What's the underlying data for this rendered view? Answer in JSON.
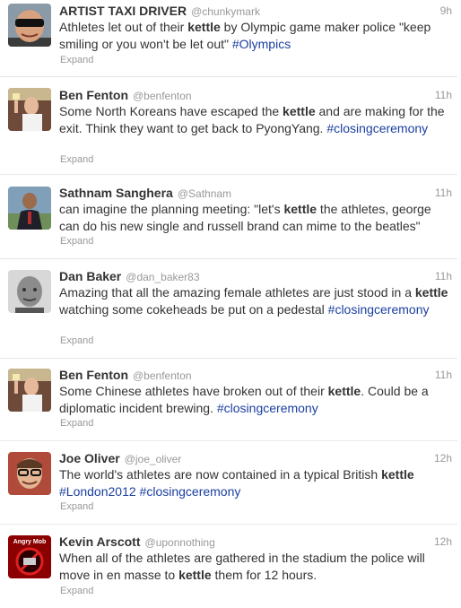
{
  "tweets": [
    {
      "name": "ARTIST TAXI DRIVER",
      "handle": "@chunkymark",
      "time": "9h",
      "avatar_icon": "sunglasses-man-avatar",
      "segments": [
        {
          "t": "Athletes let out of their "
        },
        {
          "t": "kettle",
          "kind": "bold"
        },
        {
          "t": " by Olympic game maker police \"keep smiling or you won't be let out\" "
        },
        {
          "t": "#Olympics",
          "kind": "tag"
        }
      ],
      "expand": "Expand"
    },
    {
      "name": "Ben Fenton",
      "handle": "@benfenton",
      "time": "11h",
      "avatar_icon": "man-raising-glass-avatar",
      "segments": [
        {
          "t": "Some North Koreans have escaped the "
        },
        {
          "t": "kettle",
          "kind": "bold"
        },
        {
          "t": " and are making for the exit. Think they want to get back to PyongYang. "
        },
        {
          "t": "#closingceremony",
          "kind": "tag"
        }
      ],
      "expand": "Expand"
    },
    {
      "name": "Sathnam Sanghera",
      "handle": "@Sathnam",
      "time": "11h",
      "avatar_icon": "man-in-suit-outdoors-avatar",
      "segments": [
        {
          "t": "can imagine the planning meeting: \"let's "
        },
        {
          "t": "kettle",
          "kind": "bold"
        },
        {
          "t": " the athletes, george can do his new single and russell brand can mime to the beatles\""
        }
      ],
      "expand": "Expand"
    },
    {
      "name": "Dan Baker",
      "handle": "@dan_baker83",
      "time": "11h",
      "avatar_icon": "bald-man-portrait-avatar",
      "segments": [
        {
          "t": "Amazing that all the amazing female athletes are just stood in a "
        },
        {
          "t": "kettle",
          "kind": "bold"
        },
        {
          "t": " watching some cokeheads be put on a pedestal "
        },
        {
          "t": "#closingceremony",
          "kind": "tag"
        }
      ],
      "expand": "Expand"
    },
    {
      "name": "Ben Fenton",
      "handle": "@benfenton",
      "time": "11h",
      "avatar_icon": "man-raising-glass-avatar",
      "segments": [
        {
          "t": "Some Chinese athletes have broken out of their "
        },
        {
          "t": "kettle",
          "kind": "bold"
        },
        {
          "t": ". Could be a diplomatic incident brewing. "
        },
        {
          "t": "#closingceremony",
          "kind": "tag"
        }
      ],
      "expand": "Expand"
    },
    {
      "name": "Joe Oliver",
      "handle": "@joe_oliver",
      "time": "12h",
      "avatar_icon": "man-with-glasses-avatar",
      "segments": [
        {
          "t": "The world's athletes are now contained in a typical British "
        },
        {
          "t": "kettle",
          "kind": "bold"
        },
        {
          "t": " "
        },
        {
          "t": "#London2012",
          "kind": "tag"
        },
        {
          "t": " "
        },
        {
          "t": "#closingceremony",
          "kind": "tag"
        }
      ],
      "expand": "Expand"
    },
    {
      "name": "Kevin Arscott",
      "handle": "@uponnothing",
      "time": "12h",
      "avatar_icon": "angry-mob-logo-avatar",
      "avatar_label": "Angry Mob",
      "segments": [
        {
          "t": "When all of the athletes are gathered in the stadium the police will move in en masse to "
        },
        {
          "t": "kettle",
          "kind": "bold"
        },
        {
          "t": " them for 12 hours."
        }
      ],
      "expand": "Expand"
    }
  ]
}
